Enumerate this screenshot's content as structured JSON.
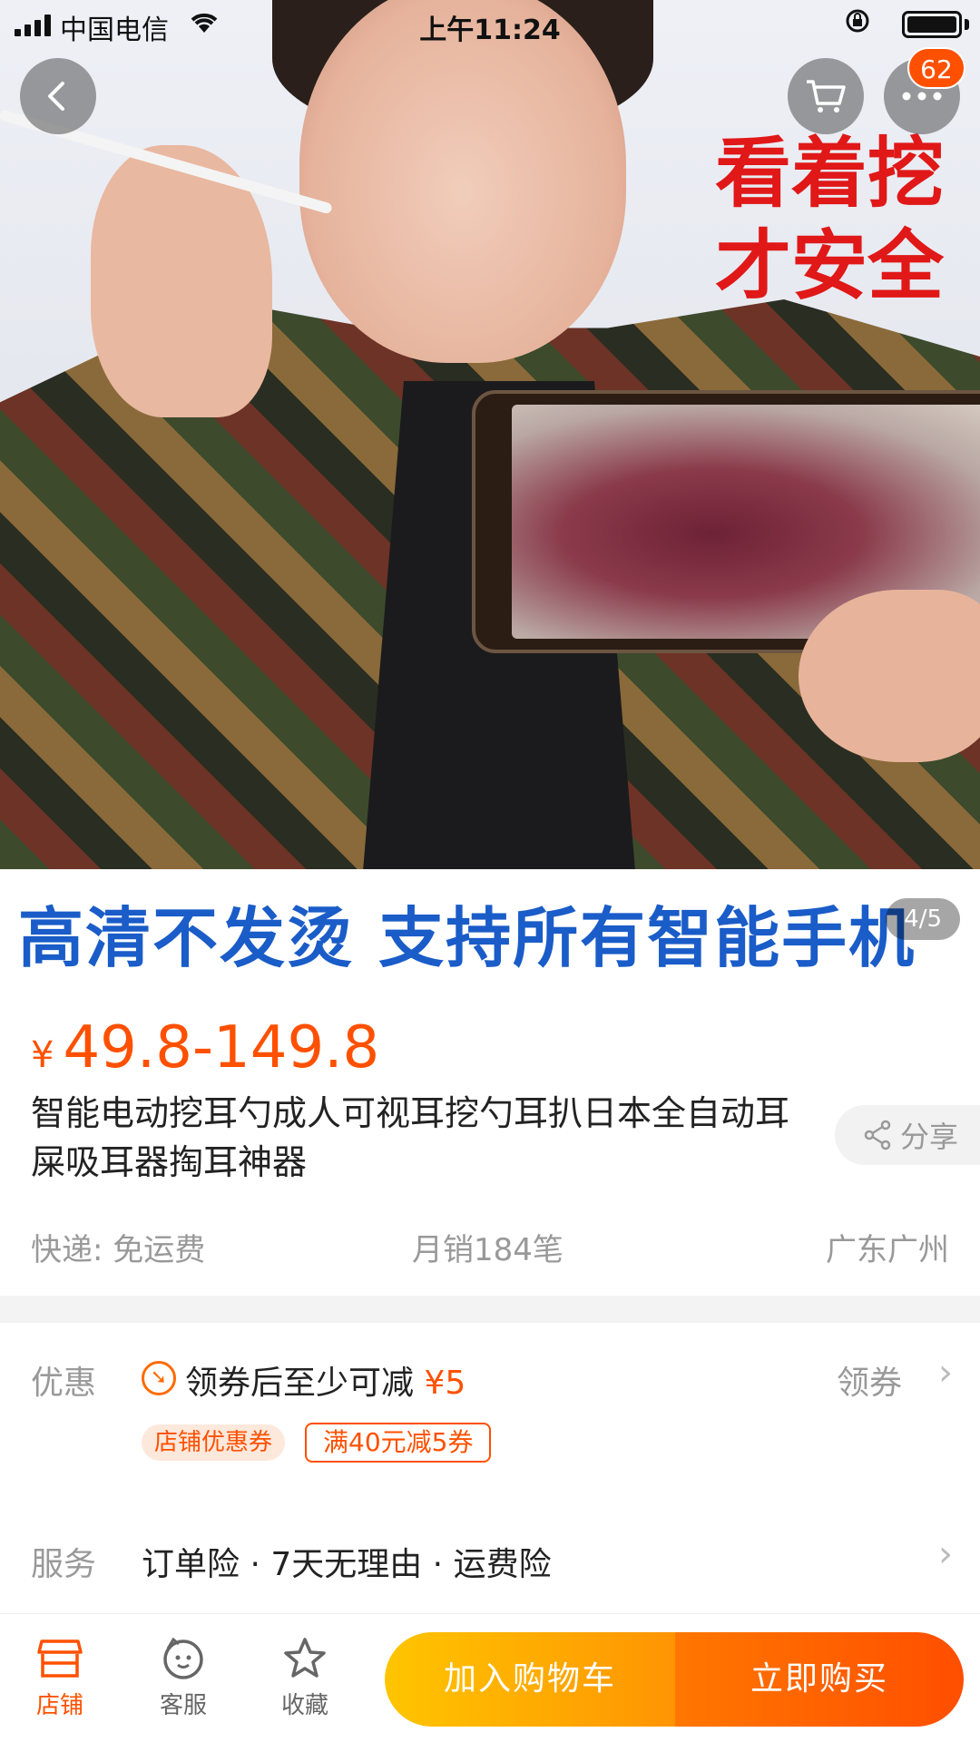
{
  "status_bar": {
    "carrier": "中国电信",
    "time": "上午11:24"
  },
  "nav": {
    "cart_badge": "62"
  },
  "hero": {
    "promo_line1": "看着挖",
    "promo_line2": "才安全",
    "banner": "高清不发烫 支持所有智能手机",
    "page_indicator": "4/5"
  },
  "product": {
    "currency": "¥",
    "price": "49.8-149.8",
    "title": "智能电动挖耳勺成人可视耳挖勺耳扒日本全自动耳屎吸耳器掏耳神器",
    "share_label": "分享",
    "shipping": "快递: 免运费",
    "monthly_sales": "月销184笔",
    "location": "广东广州"
  },
  "promo": {
    "label": "优惠",
    "text": "领券后至少可减",
    "amount": "¥5",
    "get_coupon": "领券",
    "shop_tag": "店铺优惠券",
    "condition_tag": "满40元减5券"
  },
  "service": {
    "label": "服务",
    "text": "订单险 · 7天无理由 · 运费险"
  },
  "bottom_bar": {
    "shop": "店铺",
    "customer_service": "客服",
    "favorite": "收藏",
    "add_to_cart": "加入购物车",
    "buy_now": "立即购买"
  },
  "colors": {
    "accent": "#ff5000",
    "cart_button": "#ffb300",
    "promo_red": "#e01818",
    "banner_blue": "#1a5cc8"
  }
}
